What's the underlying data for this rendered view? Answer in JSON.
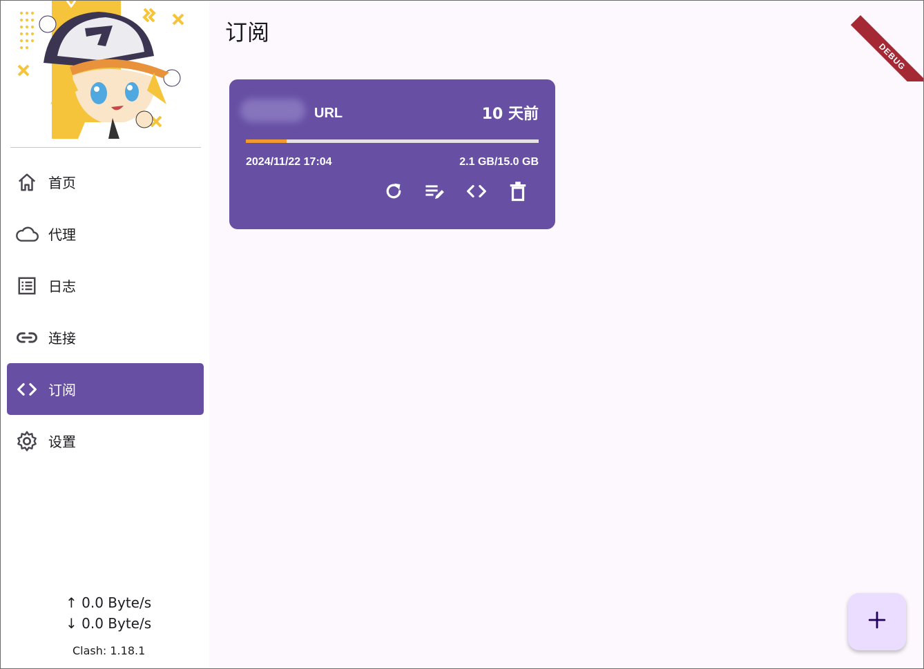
{
  "sidebar": {
    "items": [
      {
        "label": "首页",
        "icon": "home-icon"
      },
      {
        "label": "代理",
        "icon": "cloud-icon"
      },
      {
        "label": "日志",
        "icon": "list-icon"
      },
      {
        "label": "连接",
        "icon": "link-icon"
      },
      {
        "label": "订阅",
        "icon": "code-icon",
        "active": true
      },
      {
        "label": "设置",
        "icon": "gear-icon"
      }
    ],
    "upload_speed": "↑ 0.0 Byte/s",
    "download_speed": "↓ 0.0 Byte/s",
    "version": "Clash: 1.18.1"
  },
  "page": {
    "title": "订阅"
  },
  "subscription": {
    "type": "URL",
    "updated_ago": "10 天前",
    "expire_date": "2024/11/22 17:04",
    "usage": "2.1 GB/15.0 GB",
    "usage_fraction": 0.14,
    "actions": [
      "refresh-icon",
      "edit-icon",
      "code-icon",
      "delete-icon"
    ]
  },
  "debug_banner": "DEBUG",
  "colors": {
    "accent": "#6750a4",
    "progress": "#f29a32",
    "fab": "#eaddff",
    "background": "#fdf8fd"
  }
}
